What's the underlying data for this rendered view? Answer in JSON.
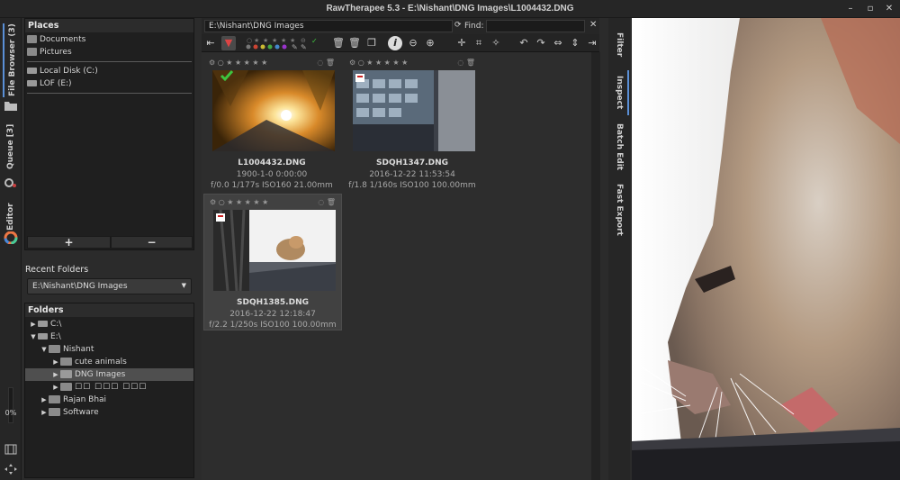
{
  "app": {
    "title": "RawTherapee 5.3 - E:\\Nishant\\DNG Images\\L1004432.DNG"
  },
  "window_controls": {
    "minimize": "–",
    "maximize": "▫",
    "close": "✕"
  },
  "left_tabs": [
    {
      "label": "File Browser (3)"
    },
    {
      "label": "Queue [3]"
    },
    {
      "label": "Editor"
    }
  ],
  "left_bottom": {
    "progress_label": "0%",
    "progress": 0
  },
  "places": {
    "header": "Places",
    "items": [
      "Documents",
      "Pictures",
      "Local Disk (C:)",
      "LOF (E:)"
    ],
    "add_label": "+",
    "remove_label": "−"
  },
  "recent_folders": {
    "header": "Recent Folders",
    "selected": "E:\\Nishant\\DNG Images"
  },
  "folders": {
    "header": "Folders",
    "tree": [
      {
        "label": "C:\\"
      },
      {
        "label": "E:\\"
      },
      {
        "label": "Nishant"
      },
      {
        "label": "cute animals"
      },
      {
        "label": "DNG Images"
      },
      {
        "label": "☐☐ ☐☐☐ ☐☐☐"
      },
      {
        "label": "Rajan Bhai"
      },
      {
        "label": "Software"
      }
    ]
  },
  "browser": {
    "path": "E:\\Nishant\\DNG Images",
    "find_label": "Find:",
    "find_value": ""
  },
  "thumbnails": [
    {
      "name": "L1004432.DNG",
      "date": "1900-1-0 0:00:00",
      "exif": "f/0.0 1/177s ISO160 21.00mm"
    },
    {
      "name": "SDQH1347.DNG",
      "date": "2016-12-22 11:53:54",
      "exif": "f/1.8 1/160s ISO100 100.00mm"
    },
    {
      "name": "SDQH1385.DNG",
      "date": "2016-12-22 12:18:47",
      "exif": "f/2.2 1/250s ISO100 100.00mm"
    }
  ],
  "right_tabs": [
    {
      "label": "Filter"
    },
    {
      "label": "Inspect"
    },
    {
      "label": "Batch Edit"
    },
    {
      "label": "Fast Export"
    }
  ],
  "colors": {
    "accent": "#5a8fd6",
    "selection": "#4f4f4f",
    "check_green": "#3ec43e"
  }
}
